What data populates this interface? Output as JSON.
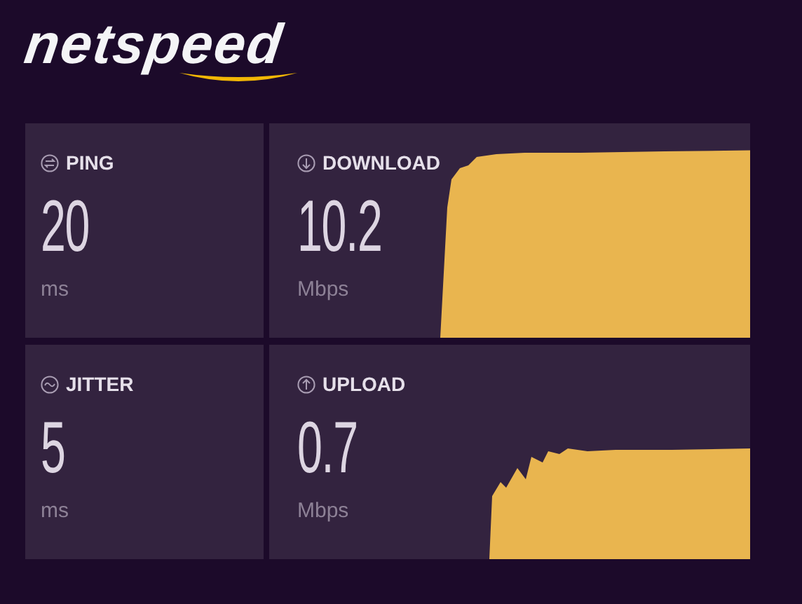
{
  "logo": {
    "text": "netspeed"
  },
  "metrics": [
    {
      "kind": "latency",
      "label": "PING",
      "value": "20",
      "unit": "ms"
    },
    {
      "kind": "speed",
      "label": "DOWNLOAD",
      "value": "10.2",
      "unit": "Mbps"
    },
    {
      "kind": "latency",
      "label": "JITTER",
      "value": "5",
      "unit": "ms"
    },
    {
      "kind": "speed",
      "label": "UPLOAD",
      "value": "0.7",
      "unit": "Mbps"
    }
  ]
}
